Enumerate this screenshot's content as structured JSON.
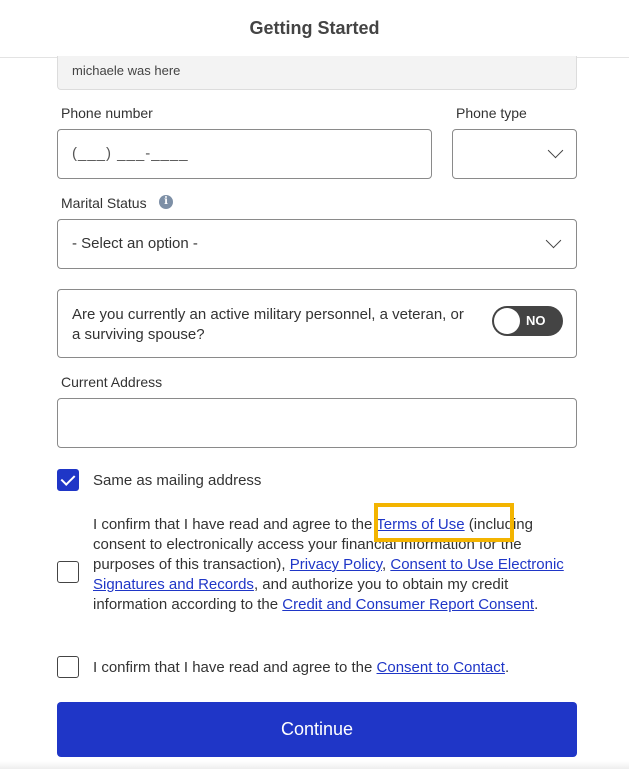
{
  "header": {
    "title": "Getting Started"
  },
  "previous_field": {
    "value": "michaele was here"
  },
  "phone": {
    "label": "Phone number",
    "placeholder": "(___) ___-____",
    "type_label": "Phone type",
    "type_value": ""
  },
  "marital": {
    "label": "Marital Status",
    "info_glyph": "i",
    "selected": "- Select an option -"
  },
  "military": {
    "question": "Are you currently an active military personnel, a veteran, or a surviving spouse?",
    "toggle_label": "NO",
    "toggle_on": false
  },
  "address": {
    "label": "Current Address",
    "value": ""
  },
  "same_mailing": {
    "label": "Same as mailing address",
    "checked": true
  },
  "consent1": {
    "checked": false,
    "t1": "I confirm that I have read and agree to the ",
    "link_terms": "Terms of Use",
    "t2": " (including consent to electronically access your financial information for the purposes of this transaction), ",
    "link_privacy": "Privacy Policy",
    "t3": ", ",
    "link_esign": "Consent to Use Electronic Signatures and Records",
    "t4": ", and authorize you to obtain my credit information according to the ",
    "link_credit": "Credit and Consumer Report Consent",
    "t5": "."
  },
  "consent2": {
    "checked": false,
    "t1": "I confirm that I have read and agree to the ",
    "link_contact": "Consent to Contact",
    "t2": "."
  },
  "continue_label": "Continue",
  "colors": {
    "primary": "#1f36c7",
    "highlight": "#f3b400",
    "toggle_off": "#444444"
  }
}
